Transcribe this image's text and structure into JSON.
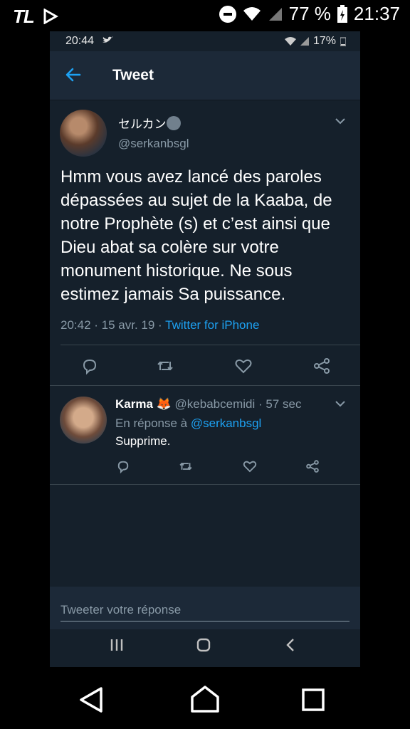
{
  "outer_status": {
    "left_icons": "TL",
    "battery": "77 %",
    "time": "21:37"
  },
  "inner_status": {
    "time": "20:44",
    "battery": "17%"
  },
  "header": {
    "title": "Tweet"
  },
  "tweet": {
    "author_name": "セルカン",
    "author_handle": "@serkanbsgl",
    "text": "Hmm vous avez lancé des paroles dépassées au sujet de la Kaaba, de notre Prophète (s) et c’est ainsi que Dieu abat sa colère sur votre monument historique. Ne sous estimez jamais Sa puissance.",
    "timestamp": "20:42 · 15 avr. 19 · ",
    "source": "Twitter for iPhone"
  },
  "reply": {
    "name": "Karma 🦊",
    "handle": "@kebabcemidi · 57 sec",
    "reply_to_prefix": "En réponse à ",
    "reply_to_handle": "@serkanbsgl",
    "text": "Supprime."
  },
  "compose": {
    "placeholder": "Tweeter votre réponse"
  },
  "colors": {
    "accent": "#1da1f2",
    "background": "#15202b",
    "secondary_text": "#8899a6"
  }
}
